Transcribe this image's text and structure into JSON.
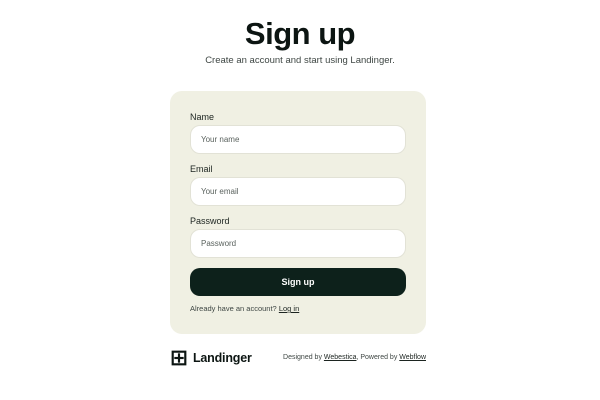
{
  "header": {
    "title": "Sign up",
    "subtitle": "Create an account and start using Landinger."
  },
  "form": {
    "name": {
      "label": "Name",
      "placeholder": "Your name",
      "value": ""
    },
    "email": {
      "label": "Email",
      "placeholder": "Your email",
      "value": ""
    },
    "password": {
      "label": "Password",
      "placeholder": "Password",
      "value": ""
    },
    "submit_label": "Sign up",
    "login_prompt": "Already have an account?",
    "login_link": "Log in"
  },
  "footer": {
    "brand": "Landinger",
    "brand_icon": "landinger-logo-icon",
    "designed_by_prefix": "Designed by",
    "designer_link": "Webestica",
    "powered_by_prefix": ", Powered by",
    "powered_link": "Webflow"
  },
  "colors": {
    "card_background": "#f0f0e3",
    "button_background": "#0d211b",
    "text_primary": "#0c1512"
  }
}
